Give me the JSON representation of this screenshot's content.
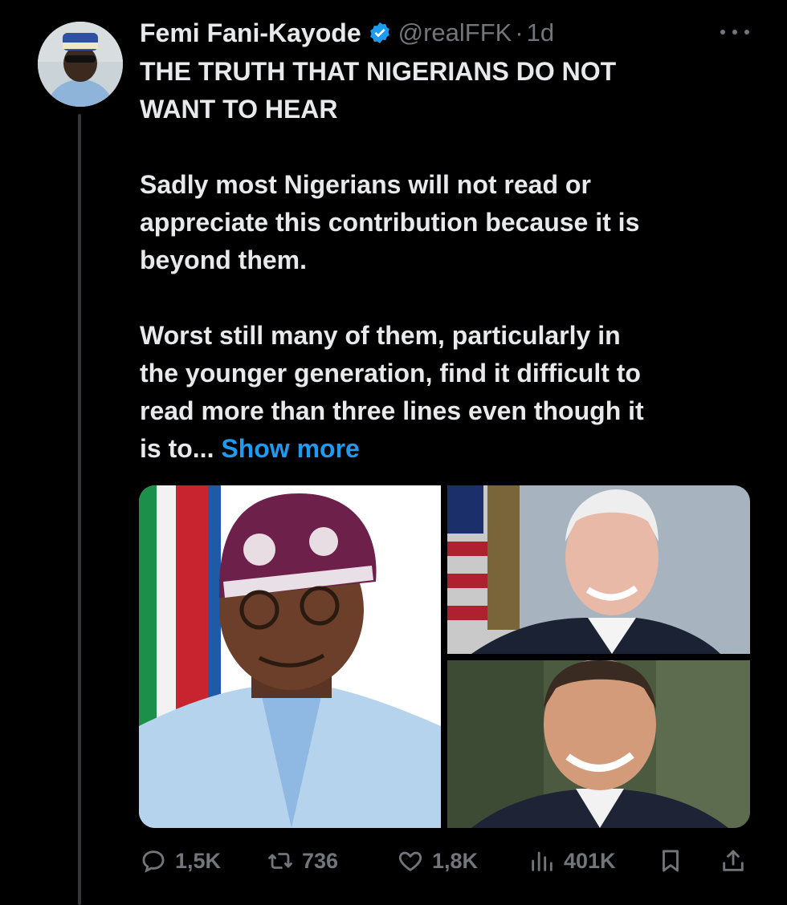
{
  "author": {
    "name": "Femi Fani-Kayode",
    "handle": "@realFFK",
    "separator": "·",
    "time": "1d",
    "verified_color": "#1d9bf0"
  },
  "tweet": {
    "lines_title": [
      "THE TRUTH THAT NIGERIANS DO NOT",
      "WANT TO HEAR"
    ],
    "para2": [
      "Sadly most Nigerians will not read or",
      "appreciate this contribution because it is",
      "beyond them."
    ],
    "para3": [
      "Worst still many of them, particularly in",
      "the younger generation, find it difficult to",
      "read more than three lines even though it"
    ],
    "para3_last": "is to...",
    "show_more": "Show more"
  },
  "media": {
    "photos": [
      "photo-man-in-agbada-and-cap",
      "photo-man-with-flag",
      "photo-smiling-man-in-suit"
    ]
  },
  "actions": {
    "replies": "1,5K",
    "reposts": "736",
    "likes": "1,8K",
    "views": "401K"
  },
  "colors": {
    "background": "#000000",
    "text": "#e7e9ea",
    "muted": "#71767b",
    "link": "#1d9bf0"
  }
}
